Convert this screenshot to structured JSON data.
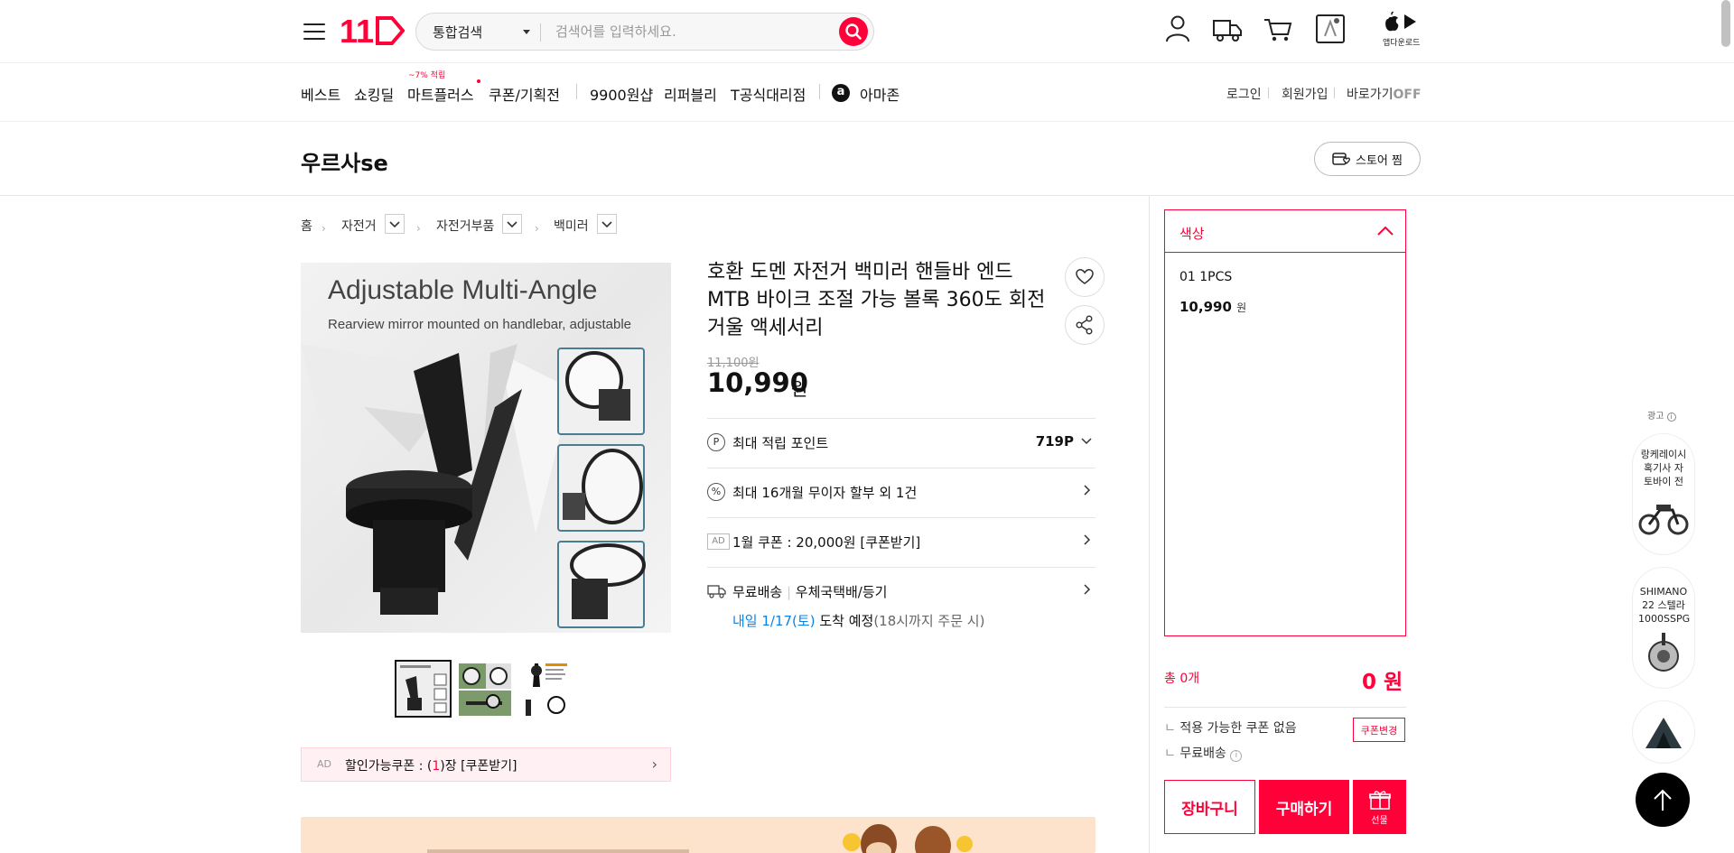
{
  "header": {
    "logo_text": "11",
    "search_category": "통합검색",
    "search_placeholder": "검색어를 입력하세요.",
    "app_download_label": "앱다운로드"
  },
  "nav": {
    "items": [
      "베스트",
      "쇼킹딜",
      "마트플러스",
      "쿠폰/기획전",
      "9900원샵",
      "리퍼블리",
      "T공식대리점",
      "아마존"
    ],
    "mart_badge": "~7% 적립",
    "amazon_icon_letter": "a",
    "utility": {
      "login": "로그인",
      "signup": "회원가입",
      "shortcut": "바로가기",
      "shortcut_state": "OFF"
    }
  },
  "store": {
    "name": "우르사se",
    "favorite_label": "스토어 찜"
  },
  "breadcrumb": [
    "홈",
    "자전거",
    "자전거부품",
    "백미러"
  ],
  "product": {
    "image_title": "Adjustable Multi-Angle",
    "image_subtitle": "Rearview mirror mounted on handlebar, adjustable",
    "title": "호환 도멘 자전거 백미러 핸들바 엔드 MTB 바이크 조절 가능 볼록 360도 회전 거울 액세서리",
    "original_price": "11,100원",
    "sale_price": "10,990",
    "sale_unit": "원",
    "points_label": "최대 적립 포인트",
    "points_icon": "P",
    "points_value": "719P",
    "installment_label": "최대 16개월 무이자 할부 외 1건",
    "installment_icon": "%",
    "ad_tag": "AD",
    "coupon_label": "1월 쿠폰 : 20,000원 [쿠폰받기]",
    "shipping_label": "무료배송",
    "shipping_method": "우체국택배/등기",
    "arrival_date": "내일 1/17(토)",
    "arrival_text": " 도착 예정",
    "arrival_note": "(18시까지 주문 시)"
  },
  "coupon_bar": {
    "ad": "AD",
    "prefix": "할인가능쿠폰 : (",
    "count": "1",
    "suffix": ")장 [쿠폰받기]"
  },
  "order": {
    "option_label": "색상",
    "option_item": "01 1PCS",
    "option_price": "10,990",
    "option_unit": "원",
    "total_label": "총 0개",
    "total_price": "0 원",
    "coupon_note": "적용 가능한 쿠폰 없음",
    "coupon_change": "쿠폰변경",
    "shipping_note": "무료배송",
    "cart_label": "장바구니",
    "buy_label": "구매하기",
    "gift_label": "선물"
  },
  "side_ads": {
    "label": "광고",
    "ad1": "랑케레이시 혹기사 자 토바이 전",
    "ad2": "SHIMANO 22 스텔라 1000SSPG"
  },
  "colors": {
    "brand": "#ff0038",
    "link_blue": "#0b83e6"
  }
}
